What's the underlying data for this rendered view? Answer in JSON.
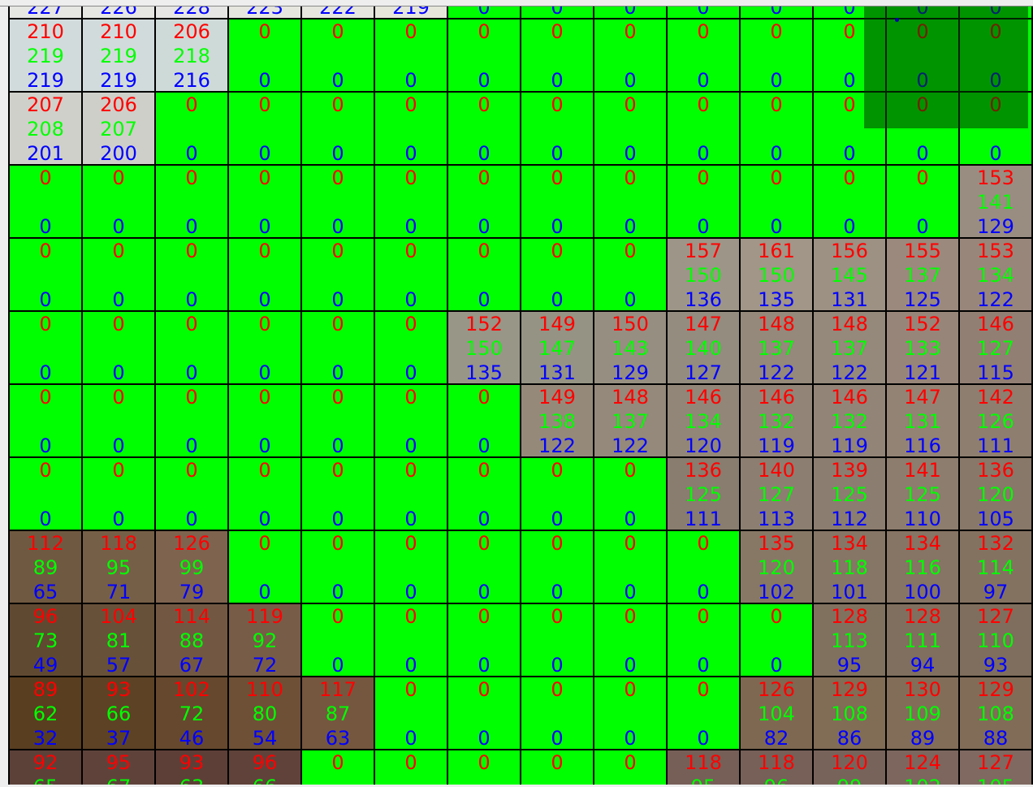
{
  "view": {
    "title": "pixel-value-grid",
    "selected_region": "top-right"
  },
  "colors": {
    "red_channel_text": "#ff0000",
    "green_channel_text": "#00ff00",
    "blue_channel_text": "#0000ff",
    "highlight_cell": "#00ff00",
    "grid_line": "#000000",
    "selection_overlay": "rgba(0,60,0,0.55)"
  },
  "grid": {
    "columns": 14,
    "rows": [
      [
        [
          null,
          null,
          227
        ],
        [
          null,
          null,
          226
        ],
        [
          null,
          null,
          228
        ],
        [
          null,
          null,
          223
        ],
        [
          null,
          null,
          222
        ],
        [
          null,
          null,
          219
        ],
        [
          0,
          0,
          0
        ],
        [
          0,
          0,
          0
        ],
        [
          0,
          0,
          0
        ],
        [
          0,
          0,
          0
        ],
        [
          0,
          0,
          0
        ],
        [
          0,
          0,
          0
        ],
        [
          0,
          0,
          0
        ],
        [
          0,
          0,
          0
        ]
      ],
      [
        [
          210,
          219,
          219
        ],
        [
          210,
          219,
          219
        ],
        [
          206,
          218,
          216
        ],
        [
          0,
          0,
          0
        ],
        [
          0,
          0,
          0
        ],
        [
          0,
          0,
          0
        ],
        [
          0,
          0,
          0
        ],
        [
          0,
          0,
          0
        ],
        [
          0,
          0,
          0
        ],
        [
          0,
          0,
          0
        ],
        [
          0,
          0,
          0
        ],
        [
          0,
          0,
          0
        ],
        [
          0,
          0,
          0
        ],
        [
          0,
          0,
          0
        ]
      ],
      [
        [
          207,
          208,
          201
        ],
        [
          206,
          207,
          200
        ],
        [
          0,
          0,
          0
        ],
        [
          0,
          0,
          0
        ],
        [
          0,
          0,
          0
        ],
        [
          0,
          0,
          0
        ],
        [
          0,
          0,
          0
        ],
        [
          0,
          0,
          0
        ],
        [
          0,
          0,
          0
        ],
        [
          0,
          0,
          0
        ],
        [
          0,
          0,
          0
        ],
        [
          0,
          0,
          0
        ],
        [
          0,
          0,
          0
        ],
        [
          0,
          0,
          0
        ]
      ],
      [
        [
          0,
          0,
          0
        ],
        [
          0,
          0,
          0
        ],
        [
          0,
          0,
          0
        ],
        [
          0,
          0,
          0
        ],
        [
          0,
          0,
          0
        ],
        [
          0,
          0,
          0
        ],
        [
          0,
          0,
          0
        ],
        [
          0,
          0,
          0
        ],
        [
          0,
          0,
          0
        ],
        [
          0,
          0,
          0
        ],
        [
          0,
          0,
          0
        ],
        [
          0,
          0,
          0
        ],
        [
          0,
          0,
          0
        ],
        [
          153,
          141,
          129
        ]
      ],
      [
        [
          0,
          0,
          0
        ],
        [
          0,
          0,
          0
        ],
        [
          0,
          0,
          0
        ],
        [
          0,
          0,
          0
        ],
        [
          0,
          0,
          0
        ],
        [
          0,
          0,
          0
        ],
        [
          0,
          0,
          0
        ],
        [
          0,
          0,
          0
        ],
        [
          0,
          0,
          0
        ],
        [
          157,
          150,
          136
        ],
        [
          161,
          150,
          135
        ],
        [
          156,
          145,
          131
        ],
        [
          155,
          137,
          125
        ],
        [
          153,
          134,
          122
        ]
      ],
      [
        [
          0,
          0,
          0
        ],
        [
          0,
          0,
          0
        ],
        [
          0,
          0,
          0
        ],
        [
          0,
          0,
          0
        ],
        [
          0,
          0,
          0
        ],
        [
          0,
          0,
          0
        ],
        [
          152,
          150,
          135
        ],
        [
          149,
          147,
          131
        ],
        [
          150,
          143,
          129
        ],
        [
          147,
          140,
          127
        ],
        [
          148,
          137,
          122
        ],
        [
          148,
          137,
          122
        ],
        [
          152,
          133,
          121
        ],
        [
          146,
          127,
          115
        ]
      ],
      [
        [
          0,
          0,
          0
        ],
        [
          0,
          0,
          0
        ],
        [
          0,
          0,
          0
        ],
        [
          0,
          0,
          0
        ],
        [
          0,
          0,
          0
        ],
        [
          0,
          0,
          0
        ],
        [
          0,
          0,
          0
        ],
        [
          149,
          138,
          122
        ],
        [
          148,
          137,
          122
        ],
        [
          146,
          134,
          120
        ],
        [
          146,
          132,
          119
        ],
        [
          146,
          132,
          119
        ],
        [
          147,
          131,
          116
        ],
        [
          142,
          126,
          111
        ]
      ],
      [
        [
          0,
          0,
          0
        ],
        [
          0,
          0,
          0
        ],
        [
          0,
          0,
          0
        ],
        [
          0,
          0,
          0
        ],
        [
          0,
          0,
          0
        ],
        [
          0,
          0,
          0
        ],
        [
          0,
          0,
          0
        ],
        [
          0,
          0,
          0
        ],
        [
          0,
          0,
          0
        ],
        [
          136,
          125,
          111
        ],
        [
          140,
          127,
          113
        ],
        [
          139,
          125,
          112
        ],
        [
          141,
          125,
          110
        ],
        [
          136,
          120,
          105
        ]
      ],
      [
        [
          112,
          89,
          65
        ],
        [
          118,
          95,
          71
        ],
        [
          126,
          99,
          79
        ],
        [
          0,
          0,
          0
        ],
        [
          0,
          0,
          0
        ],
        [
          0,
          0,
          0
        ],
        [
          0,
          0,
          0
        ],
        [
          0,
          0,
          0
        ],
        [
          0,
          0,
          0
        ],
        [
          0,
          0,
          0
        ],
        [
          135,
          120,
          102
        ],
        [
          134,
          118,
          101
        ],
        [
          134,
          116,
          100
        ],
        [
          132,
          114,
          97
        ]
      ],
      [
        [
          96,
          73,
          49
        ],
        [
          104,
          81,
          57
        ],
        [
          114,
          88,
          67
        ],
        [
          119,
          92,
          72
        ],
        [
          0,
          0,
          0
        ],
        [
          0,
          0,
          0
        ],
        [
          0,
          0,
          0
        ],
        [
          0,
          0,
          0
        ],
        [
          0,
          0,
          0
        ],
        [
          0,
          0,
          0
        ],
        [
          0,
          0,
          0
        ],
        [
          128,
          113,
          95
        ],
        [
          128,
          111,
          94
        ],
        [
          127,
          110,
          93
        ]
      ],
      [
        [
          89,
          62,
          32
        ],
        [
          93,
          66,
          37
        ],
        [
          102,
          72,
          46
        ],
        [
          110,
          80,
          54
        ],
        [
          117,
          87,
          63
        ],
        [
          0,
          0,
          0
        ],
        [
          0,
          0,
          0
        ],
        [
          0,
          0,
          0
        ],
        [
          0,
          0,
          0
        ],
        [
          0,
          0,
          0
        ],
        [
          126,
          104,
          82
        ],
        [
          129,
          108,
          86
        ],
        [
          130,
          109,
          89
        ],
        [
          129,
          108,
          88
        ]
      ],
      [
        [
          92,
          65,
          null
        ],
        [
          95,
          67,
          null
        ],
        [
          93,
          63,
          null
        ],
        [
          96,
          66,
          null
        ],
        [
          0,
          0,
          0
        ],
        [
          0,
          0,
          0
        ],
        [
          0,
          0,
          0
        ],
        [
          0,
          0,
          0
        ],
        [
          0,
          0,
          0
        ],
        [
          118,
          95,
          null
        ],
        [
          118,
          96,
          null
        ],
        [
          120,
          99,
          null
        ],
        [
          124,
          102,
          null
        ],
        [
          127,
          105,
          null
        ]
      ]
    ]
  }
}
